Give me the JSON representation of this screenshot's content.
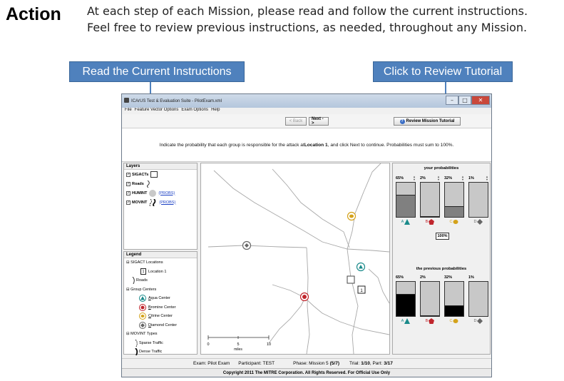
{
  "slide": {
    "title": "Action",
    "line1": "At each step of each Mission, please read and follow the current instructions.",
    "line2": "Feel free to review previous instructions, as needed, throughout any Mission."
  },
  "callouts": {
    "read_current": "Read the Current Instructions",
    "review_tutorial": "Click to Review Tutorial"
  },
  "window": {
    "title": "ICArUS Test & Evaluation Suite - PilotExam.xml",
    "controls": {
      "minimize": "–",
      "maximize": "□",
      "close": "✕"
    },
    "menu": [
      "File",
      "Feature Vector Options",
      "Exam Options",
      "Help"
    ]
  },
  "toolbar": {
    "back": "< Back",
    "next": "Next ->",
    "review": "Review Mission Tutorial",
    "help_glyph": "?"
  },
  "instruction": {
    "before": "Indicate the probability that each group is responsible for the attack at ",
    "location": "Location 1",
    "after": ", and click Next to continue. Probabilities must sum to 100%."
  },
  "layers": {
    "header": "Layers",
    "check": "✓",
    "items": [
      {
        "label": "SIGACTs"
      },
      {
        "label": "Roads"
      },
      {
        "label": "HUMINT",
        "link": "(PROBS)"
      },
      {
        "label": "MOVINT",
        "link": "(PROBS)"
      }
    ]
  },
  "legend": {
    "header": "Legend",
    "sigact_group": "SIGACT Locations",
    "location_marker": "1",
    "location_label": "Location 1",
    "roads": "Roads",
    "group_centers": "Group Centers",
    "centers": [
      {
        "key": "A",
        "rest": "qua Center"
      },
      {
        "key": "B",
        "rest": "romine Center"
      },
      {
        "key": "C",
        "rest": "itrine Center"
      },
      {
        "key": "D",
        "rest": "iamond Center"
      }
    ],
    "movint_types": "MOVINT Types",
    "sparse": "Sparse Traffic",
    "dense": "Dense Traffic",
    "expand_glyph": "⊟"
  },
  "map": {
    "scale_ticks": [
      "0",
      "5",
      "10"
    ],
    "scale_unit": "miles",
    "location_marker": "1"
  },
  "your_probabilities": {
    "title": "your probabilities",
    "groups": [
      {
        "label": "A",
        "value": "65%",
        "fraction": 0.65,
        "color": "#1a8a8a",
        "icon": "triangle-icon"
      },
      {
        "label": "B",
        "value": "2%",
        "fraction": 0.02,
        "color": "#c0262d",
        "icon": "pentagon-icon"
      },
      {
        "label": "C",
        "value": "32%",
        "fraction": 0.32,
        "color": "#d4a21a",
        "icon": "leaf-icon"
      },
      {
        "label": "D",
        "value": "1%",
        "fraction": 0.01,
        "color": "#666666",
        "icon": "diamond-icon"
      }
    ],
    "total": "100%"
  },
  "previous_probabilities": {
    "title": "the previous probabilities",
    "groups": [
      {
        "label": "A",
        "value": "65%",
        "fraction": 0.65
      },
      {
        "label": "B",
        "value": "2%",
        "fraction": 0.02
      },
      {
        "label": "C",
        "value": "32%",
        "fraction": 0.32
      },
      {
        "label": "D",
        "value": "1%",
        "fraction": 0.01
      }
    ]
  },
  "status": {
    "exam": "Exam: Pilot Exam",
    "participant": "Participant: TEST",
    "phase_label": "Phase: Mission 5",
    "phase_step": "(5/7)",
    "trial_label": "Trial:",
    "trial_value": "1/10",
    "part_label": ", Part:",
    "part_value": "3/17"
  },
  "copyright": "Copyright 2011 The MITRE Corporation. All Rights Reserved. For Official Use Only"
}
